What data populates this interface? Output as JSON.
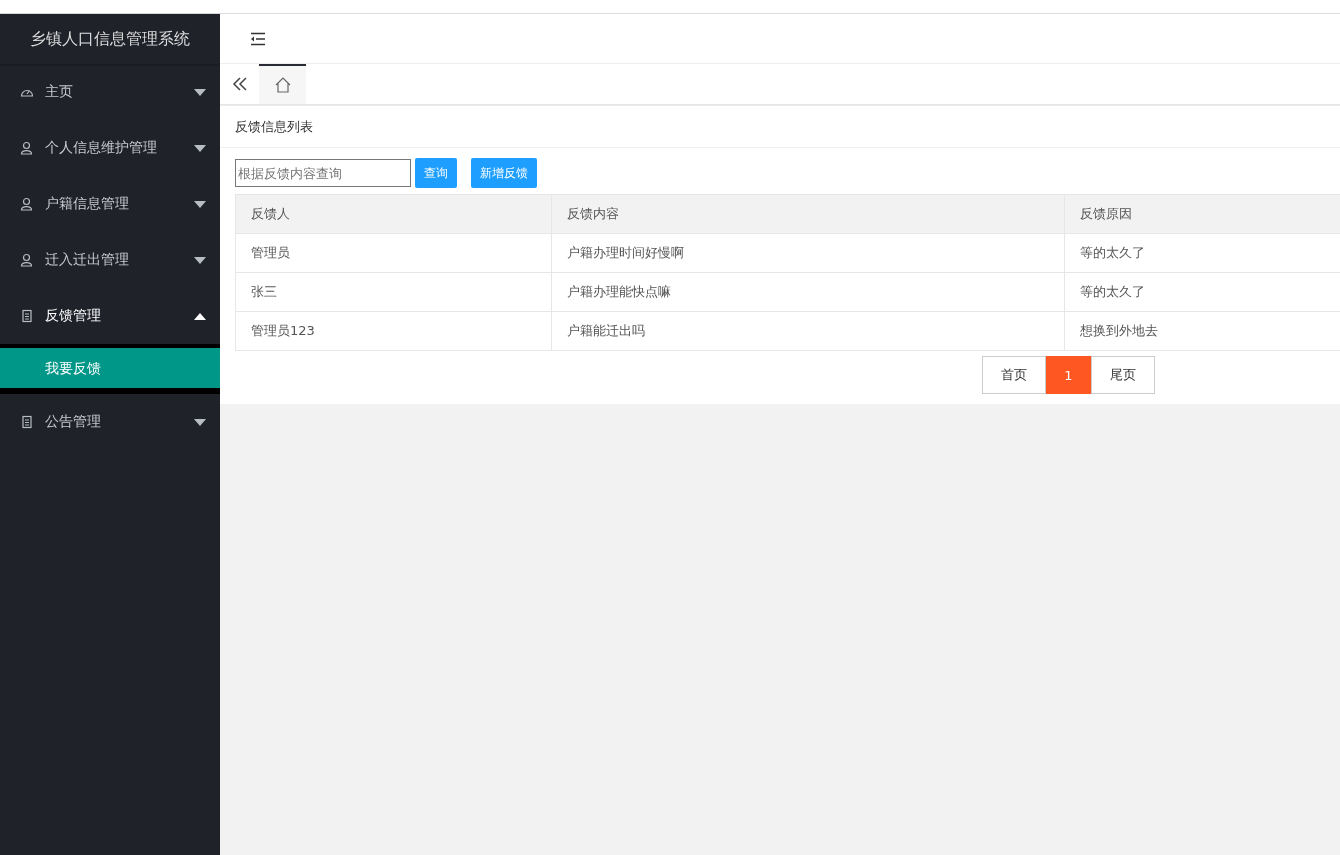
{
  "app_title": "乡镇人口信息管理系统",
  "sidebar": {
    "items": [
      {
        "label": "主页",
        "kind": "dashboard",
        "expanded": false
      },
      {
        "label": "个人信息维护管理",
        "kind": "user",
        "expanded": false
      },
      {
        "label": "户籍信息管理",
        "kind": "user",
        "expanded": false
      },
      {
        "label": "迁入迁出管理",
        "kind": "user",
        "expanded": false
      },
      {
        "label": "反馈管理",
        "kind": "document",
        "expanded": true,
        "children": [
          {
            "label": "我要反馈",
            "selected": true
          }
        ]
      },
      {
        "label": "公告管理",
        "kind": "document",
        "expanded": false
      }
    ]
  },
  "tabs": [
    {
      "kind": "home",
      "selected": true
    }
  ],
  "panel_title": "反馈信息列表",
  "search": {
    "placeholder": "根据反馈内容查询"
  },
  "buttons": [
    "查询",
    "新增反馈"
  ],
  "table": {
    "columns": [
      "反馈人",
      "反馈内容",
      "反馈原因"
    ],
    "rows": [
      [
        "管理员",
        "户籍办理时间好慢啊",
        "等的太久了"
      ],
      [
        "张三",
        "户籍办理能快点嘛",
        "等的太久了"
      ],
      [
        "管理员123",
        "户籍能迁出吗",
        "想换到外地去"
      ]
    ]
  },
  "pagination": {
    "first": "首页",
    "pages": [
      {
        "label": "1",
        "selected": true
      }
    ],
    "last": "尾页"
  }
}
